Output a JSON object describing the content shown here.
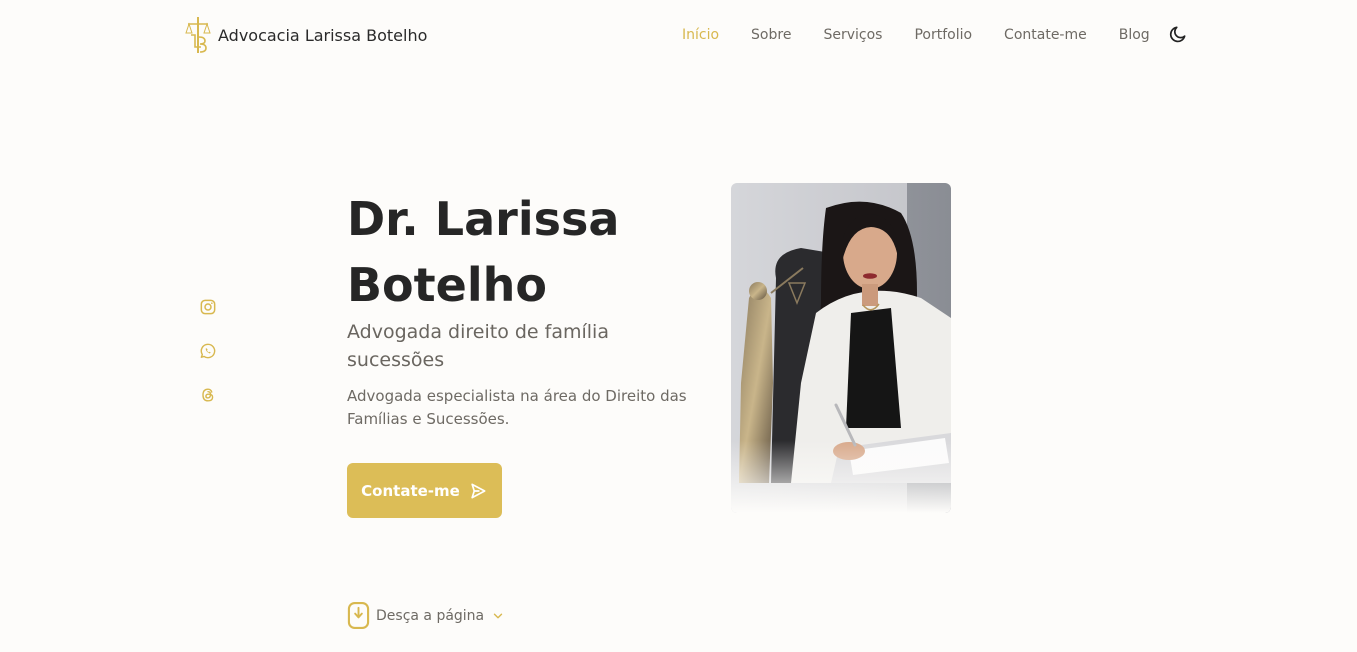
{
  "header": {
    "brand": "Advocacia Larissa Botelho",
    "logo_icon": "scales-monogram-logo",
    "nav": [
      {
        "label": "Início",
        "active": true
      },
      {
        "label": "Sobre"
      },
      {
        "label": "Serviços"
      },
      {
        "label": "Portfolio"
      },
      {
        "label": "Contate-me"
      },
      {
        "label": "Blog"
      }
    ],
    "theme_toggle_icon": "moon-icon"
  },
  "socials": [
    {
      "icon": "instagram-icon"
    },
    {
      "icon": "whatsapp-icon"
    },
    {
      "icon": "threads-icon"
    }
  ],
  "hero": {
    "title": "Dr. Larissa Botelho",
    "subtitle": "Advogada direito de família sucessões",
    "description": "Advogada especialista na área do Direito das Famílias e Sucessões.",
    "cta_label": "Contate-me",
    "cta_icon": "send-icon"
  },
  "scroll": {
    "label": "Desça a página",
    "icon": "mouse-icon",
    "chevron": "chevron-down-icon"
  },
  "colors": {
    "accent": "#dcbd57",
    "text": "#262626",
    "muted": "#6e6a64",
    "background": "#fdfcfa"
  }
}
